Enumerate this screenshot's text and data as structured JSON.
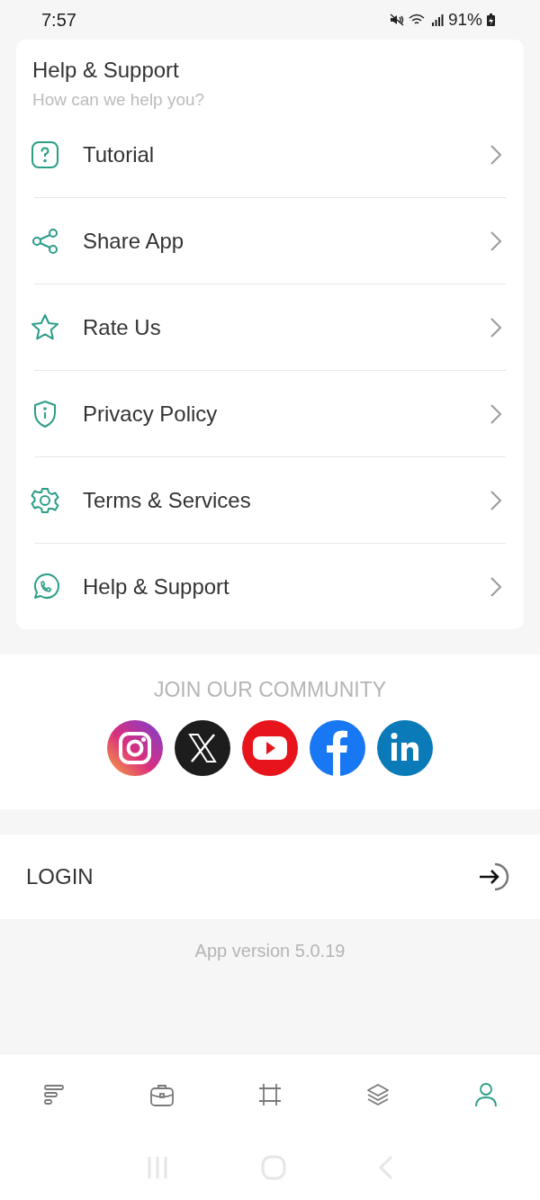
{
  "status_bar": {
    "time": "7:57",
    "battery": "91%"
  },
  "card": {
    "title": "Help & Support",
    "subtitle": "How can we help you?",
    "items": [
      {
        "kind": "question",
        "label": "Tutorial"
      },
      {
        "kind": "share",
        "label": "Share App"
      },
      {
        "kind": "star",
        "label": "Rate Us"
      },
      {
        "kind": "shield",
        "label": "Privacy Policy"
      },
      {
        "kind": "gear",
        "label": "Terms & Services"
      },
      {
        "kind": "phone",
        "label": "Help & Support"
      }
    ]
  },
  "community": {
    "title": "JOIN OUR COMMUNITY",
    "links": [
      {
        "kind": "instagram"
      },
      {
        "kind": "x"
      },
      {
        "kind": "youtube"
      },
      {
        "kind": "facebook"
      },
      {
        "kind": "linkedin"
      }
    ]
  },
  "login": {
    "label": "LOGIN"
  },
  "version": "App version 5.0.19",
  "bottom_nav": [
    {
      "kind": "bars",
      "selected": false
    },
    {
      "kind": "briefcase",
      "selected": false
    },
    {
      "kind": "crop",
      "selected": false
    },
    {
      "kind": "layers",
      "selected": false
    },
    {
      "kind": "person",
      "selected": true
    }
  ]
}
